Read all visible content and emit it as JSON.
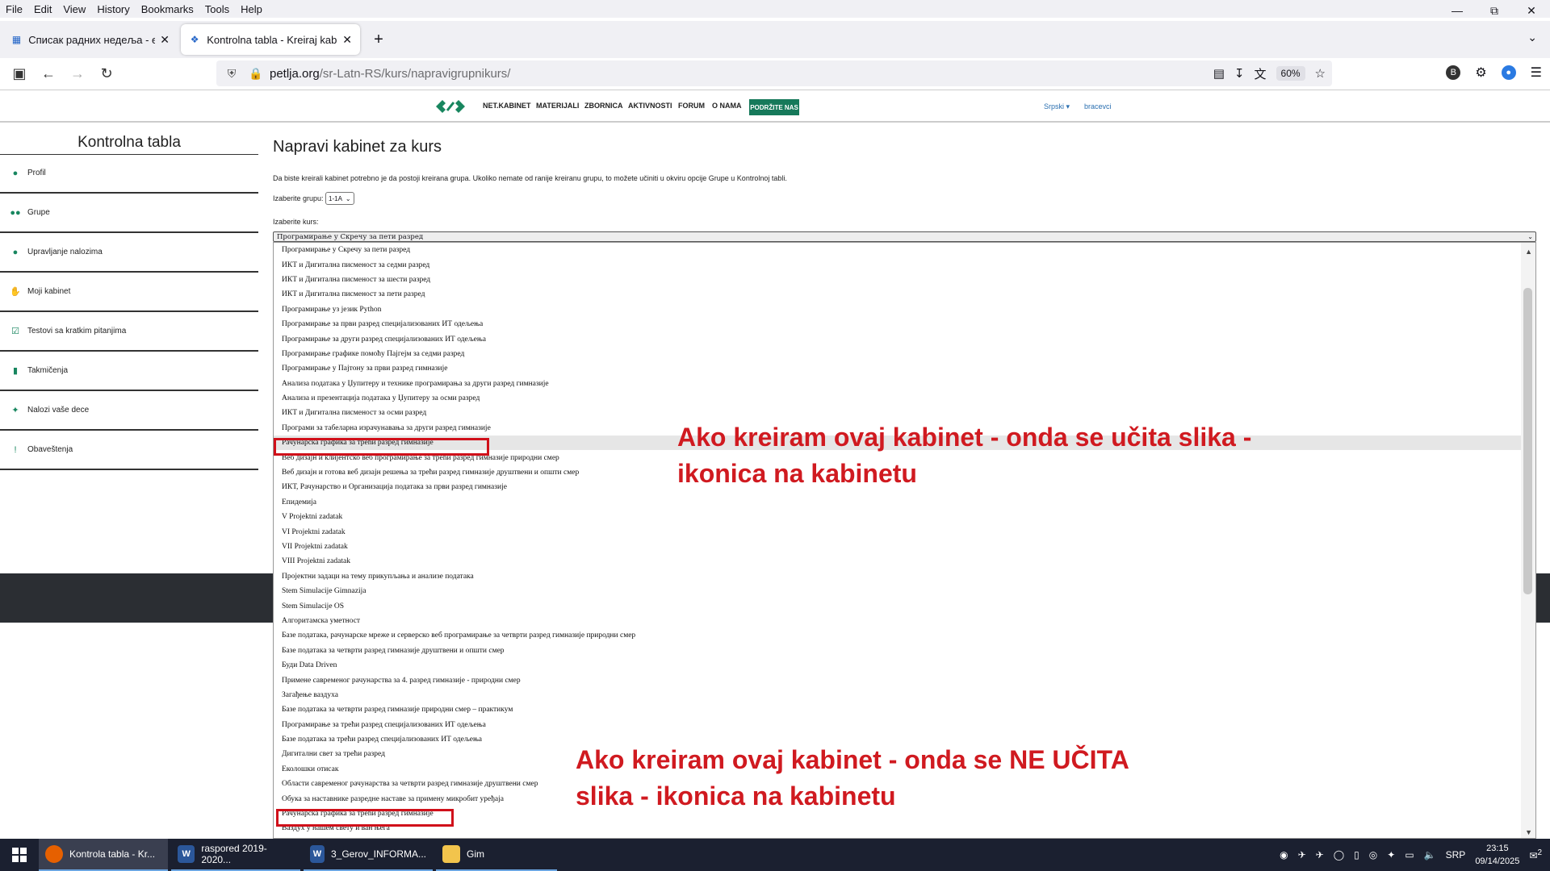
{
  "menu": [
    "File",
    "Edit",
    "View",
    "History",
    "Bookmarks",
    "Tools",
    "Help"
  ],
  "tabs": [
    {
      "title": "Списак радних недеља - esDne",
      "active": false
    },
    {
      "title": "Kontrolna tabla - Kreiraj kabinet",
      "active": true
    }
  ],
  "url": {
    "host": "petlja.org",
    "path": "/sr-Latn-RS/kurs/napravigrupnikurs/",
    "zoom": "60%"
  },
  "site": {
    "nav": [
      "NET.KABINET",
      "MATERIJALI",
      "ZBORNICA",
      "AKTIVNOSTI",
      "FORUM",
      "O NAMA"
    ],
    "support": "PODRŽITE NAS",
    "lang": "Srpski",
    "user": "bracevci"
  },
  "sidebar": {
    "title": "Kontrolna tabla",
    "items": [
      {
        "label": "Profil",
        "icon": "user-icon"
      },
      {
        "label": "Grupe",
        "icon": "users-icon"
      },
      {
        "label": "Upravljanje nalozima",
        "icon": "user-settings-icon"
      },
      {
        "label": "Moji kabinet",
        "icon": "hand-icon"
      },
      {
        "label": "Testovi sa kratkim pitanjima",
        "icon": "check-square-icon"
      },
      {
        "label": "Takmičenja",
        "icon": "bar-chart-icon"
      },
      {
        "label": "Nalozi vaše dece",
        "icon": "child-icon"
      },
      {
        "label": "Obaveštenja",
        "icon": "exclamation-icon"
      }
    ]
  },
  "main": {
    "title": "Napravi kabinet za kurs",
    "intro": "Da biste kreirali kabinet potrebno je da postoji kreirana grupa. Ukoliko nemate od ranije kreiranu grupu, to možete učiniti u okviru opcije Grupe u Kontrolnoj tabli.",
    "group_label": "Izaberite grupu:",
    "group_value": "1-1A",
    "course_label": "Izaberite kurs:",
    "course_value": "Програмирање у Скречу за пети разред"
  },
  "courses": [
    "Програмирање у Скречу за пети разред",
    "ИКТ и Дигитална писменост за седми разред",
    "ИКТ и Дигитална писменост за шести разред",
    "ИКТ и Дигитална писменост за пети разред",
    "Програмирање уз језик Python",
    "Програмирање за први разред специјализованих ИТ одељења",
    "Програмирање за други разред специјализованих ИТ одељења",
    "Програмирање графике помоћу Пајгејм за седми разред",
    "Програмирање у Пајтону за први разред гимназије",
    "Анализа података у Џупитеру и технике програмирања за други разред гимназије",
    "Анализа и презентација података у Џупитеру за осми разред",
    "ИКТ и Дигитална писменост за осми разред",
    "Програми за табеларна израчунавања за други разред гимназије",
    "Рачунарска графика за трећи разред гимназије",
    "Веб дизајн и клијентско веб програмирање за трећи разред гимназије природни смер",
    "Веб дизајн и готова веб дизајн решења за трећи разред гимназије друштвени и општи смер",
    "ИКТ, Рачунарство и Организација података за први разред гимназије",
    "Епидемија",
    "V Projektni zadatak",
    "VI Projektni zadatak",
    "VII Projektni zadatak",
    "VIII Projektni zadatak",
    "Пројектни задаци на тему прикупљања и анализе података",
    "Stem Simulacije Gimnazija",
    "Stem Simulacije OS",
    "Алгоритамска уметност",
    "Базе података, рачунарске мреже и серверско веб програмирање за четврти разред гимназије природни смер",
    "Базе података за четврти разред гимназије друштвени и општи смер",
    "Буди Data Driven",
    "Примене савременог рачунарства за 4. разред гимназије - природни смер",
    "Загађење ваздуха",
    "Базе података за четврти разред гимназије природни смер – практикум",
    "Програмирање за трећи разред специјализованих ИТ одељења",
    "Базе података за трећи разред специјализованих ИТ одељења",
    "Дигитални свет за трећи разред",
    "Еколошки отисак",
    "Области савременог рачунарства за четврти разред гимназије друштвени смер",
    "Обука за наставнике разредне наставе за примену микробит уређаја",
    "Рачунарска графика за трећи разред гимназије",
    "Ваздух у нашем свету и ван њега"
  ],
  "annotations": {
    "top": [
      "Ako kreiram ovaj kabinet - onda se učita slika -",
      "ikonica na kabinetu"
    ],
    "bottom": [
      "Ako kreiram ovaj kabinet - onda se NE UČITA",
      "slika - ikonica na kabinetu"
    ],
    "color": "#d0101a"
  },
  "taskbar": {
    "apps": [
      {
        "label": "Kontrola tabla - Kr...",
        "icon": "firefox-icon",
        "active": true
      },
      {
        "label": "raspored 2019-2020...",
        "icon": "word-icon",
        "active": false
      },
      {
        "label": "3_Gerov_INFORMA...",
        "icon": "word-icon",
        "active": false
      },
      {
        "label": "Gim",
        "icon": "folder-icon",
        "active": false
      }
    ],
    "lang": "SRP",
    "time": "23:15",
    "date": "09/14/2025",
    "notif": "2"
  }
}
